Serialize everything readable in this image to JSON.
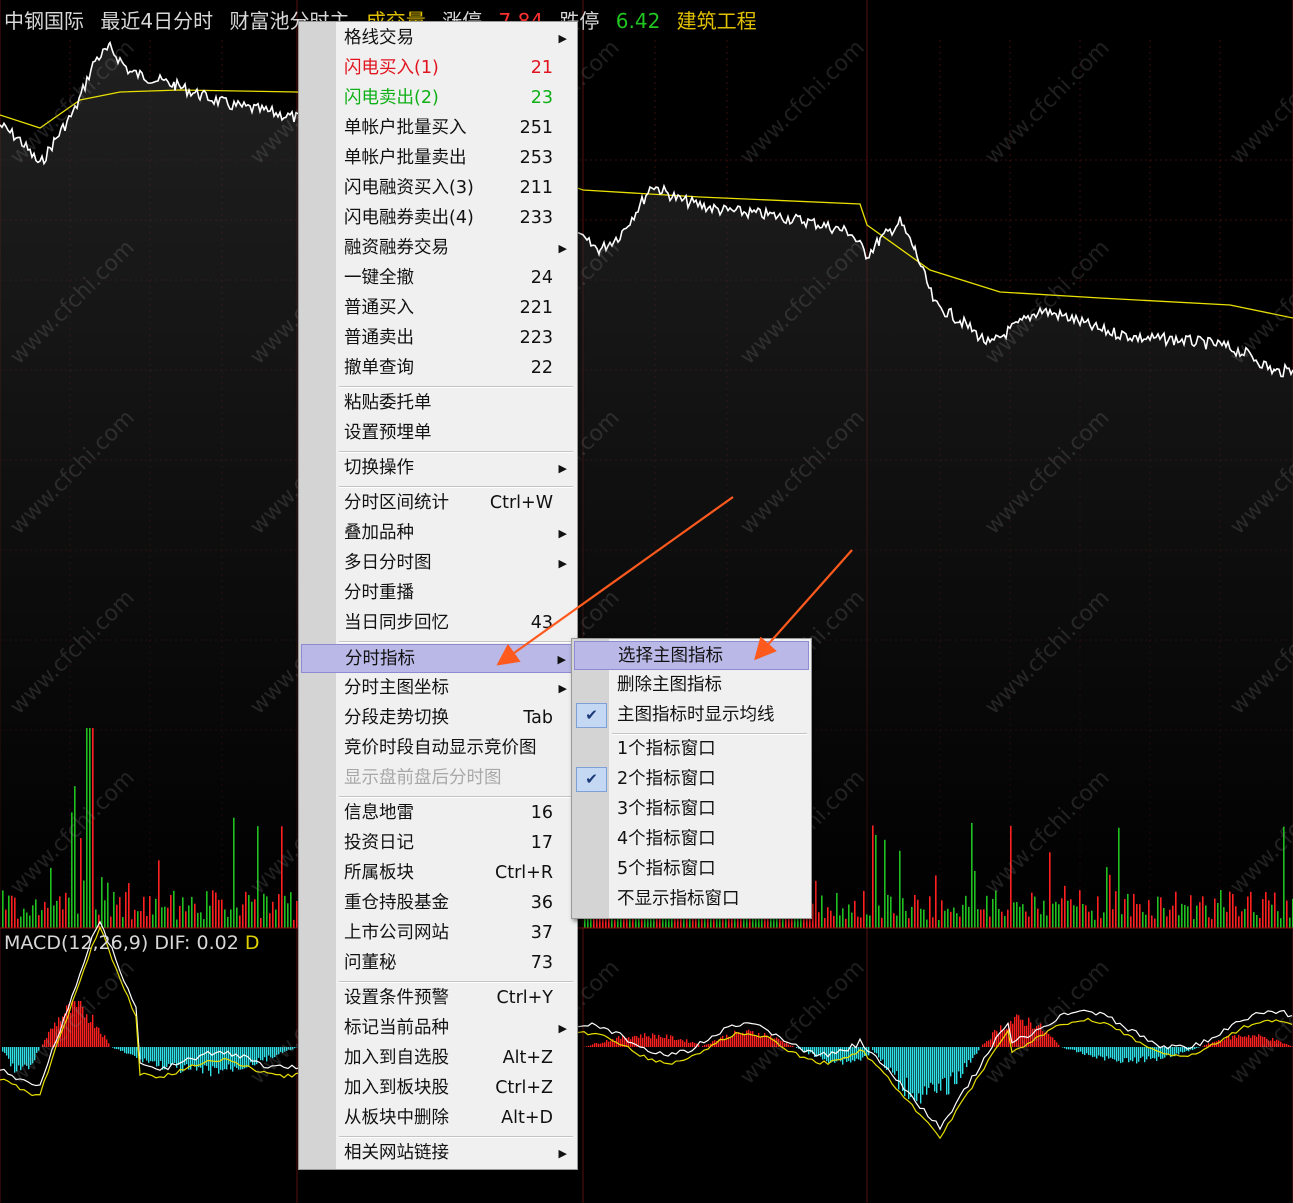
{
  "header": {
    "stock_name": "中钢国际",
    "period": "最近4日分时",
    "flow_label": "财富池分时主",
    "volume_label": "成交量",
    "limit_up_label": "涨停",
    "limit_up_value": "7.84",
    "limit_down_label": "跌停",
    "limit_down_value": "6.42",
    "sector": "建筑工程"
  },
  "macd": {
    "label": "MACD(12,26,9)",
    "dif_label": "DIF:",
    "dif_value": "0.02",
    "dea_label": "D"
  },
  "watermark_text": "www.cfchi.com",
  "colors": {
    "price_line": "#ffffff",
    "avg_line": "#e8e000",
    "vol_up": "#ff2020",
    "vol_down": "#20c020",
    "macd_pos": "#ff2020",
    "macd_neg": "#30e0e8",
    "menu_highlight": "#b9b8e6",
    "annotation_arrow": "#ff5a1e"
  },
  "context_menu": {
    "items": [
      {
        "label": "格线交易",
        "shortcut": "",
        "submenu": true
      },
      {
        "label": "闪电买入(1)",
        "shortcut": "21",
        "style": "red"
      },
      {
        "label": "闪电卖出(2)",
        "shortcut": "23",
        "style": "green"
      },
      {
        "label": "单帐户批量买入",
        "shortcut": "251"
      },
      {
        "label": "单帐户批量卖出",
        "shortcut": "253"
      },
      {
        "label": "闪电融资买入(3)",
        "shortcut": "211"
      },
      {
        "label": "闪电融券卖出(4)",
        "shortcut": "233"
      },
      {
        "label": "融资融券交易",
        "shortcut": "",
        "submenu": true
      },
      {
        "label": "一键全撤",
        "shortcut": "24"
      },
      {
        "label": "普通买入",
        "shortcut": "221"
      },
      {
        "label": "普通卖出",
        "shortcut": "223"
      },
      {
        "label": "撤单查询",
        "shortcut": "22"
      },
      {
        "label": "粘贴委托单",
        "shortcut": ""
      },
      {
        "label": "设置预埋单",
        "shortcut": ""
      },
      {
        "label": "切换操作",
        "shortcut": "",
        "submenu": true
      },
      {
        "label": "分时区间统计",
        "shortcut": "Ctrl+W"
      },
      {
        "label": "叠加品种",
        "shortcut": "",
        "submenu": true
      },
      {
        "label": "多日分时图",
        "shortcut": "",
        "submenu": true
      },
      {
        "label": "分时重播",
        "shortcut": ""
      },
      {
        "label": "当日同步回忆",
        "shortcut": "43"
      },
      {
        "label": "分时指标",
        "shortcut": "",
        "submenu": true,
        "highlighted": true
      },
      {
        "label": "分时主图坐标",
        "shortcut": "",
        "submenu": true
      },
      {
        "label": "分段走势切换",
        "shortcut": "Tab"
      },
      {
        "label": "竞价时段自动显示竞价图",
        "shortcut": ""
      },
      {
        "label": "显示盘前盘后分时图",
        "shortcut": "",
        "disabled": true
      },
      {
        "label": "信息地雷",
        "shortcut": "16"
      },
      {
        "label": "投资日记",
        "shortcut": "17"
      },
      {
        "label": "所属板块",
        "shortcut": "Ctrl+R"
      },
      {
        "label": "重仓持股基金",
        "shortcut": "36"
      },
      {
        "label": "上市公司网站",
        "shortcut": "37"
      },
      {
        "label": "问董秘",
        "shortcut": "73"
      },
      {
        "label": "设置条件预警",
        "shortcut": "Ctrl+Y"
      },
      {
        "label": "标记当前品种",
        "shortcut": "",
        "submenu": true
      },
      {
        "label": "加入到自选股",
        "shortcut": "Alt+Z"
      },
      {
        "label": "加入到板块股",
        "shortcut": "Ctrl+Z"
      },
      {
        "label": "从板块中删除",
        "shortcut": "Alt+D"
      },
      {
        "label": "相关网站链接",
        "shortcut": "",
        "submenu": true
      }
    ]
  },
  "submenu": {
    "items": [
      {
        "label": "选择主图指标",
        "highlighted": true
      },
      {
        "label": "删除主图指标"
      },
      {
        "label": "主图指标时显示均线",
        "checked": true
      },
      {
        "label": "1个指标窗口"
      },
      {
        "label": "2个指标窗口",
        "checked": true
      },
      {
        "label": "3个指标窗口"
      },
      {
        "label": "4个指标窗口"
      },
      {
        "label": "5个指标窗口"
      },
      {
        "label": "不显示指标窗口"
      }
    ]
  }
}
